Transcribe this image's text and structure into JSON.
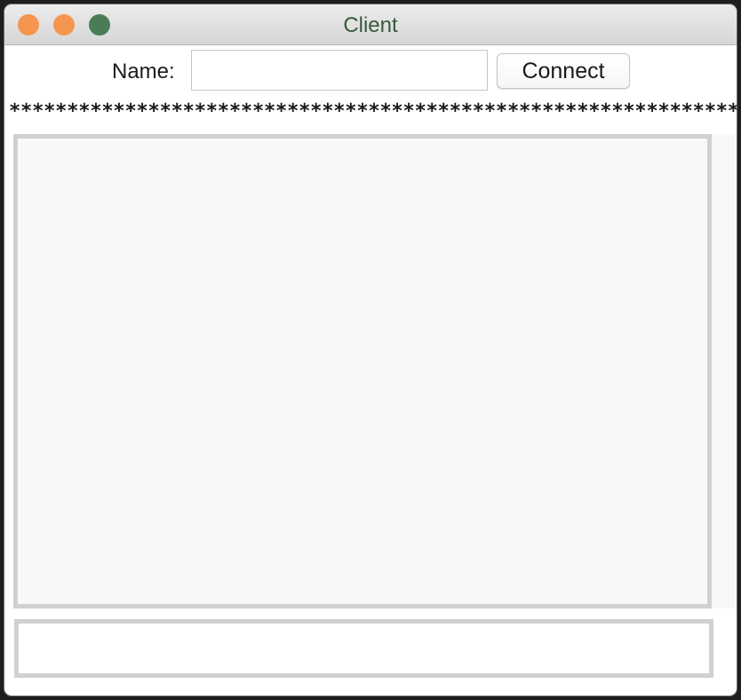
{
  "window": {
    "title": "Client"
  },
  "toolbar": {
    "name_label": "Name:",
    "name_value": "",
    "connect_label": "Connect"
  },
  "separator": {
    "text": "*************************************************************************"
  },
  "messages": {
    "content": ""
  },
  "entry": {
    "value": ""
  },
  "colors": {
    "close": "#f6954f",
    "minimize": "#f6954f",
    "maximize": "#4a7c56",
    "title_text": "#365a3b",
    "frame_border": "#d0d0d0"
  },
  "icons": {
    "close": "close-button-dot",
    "minimize": "minimize-button-dot",
    "maximize": "zoom-button-dot"
  }
}
